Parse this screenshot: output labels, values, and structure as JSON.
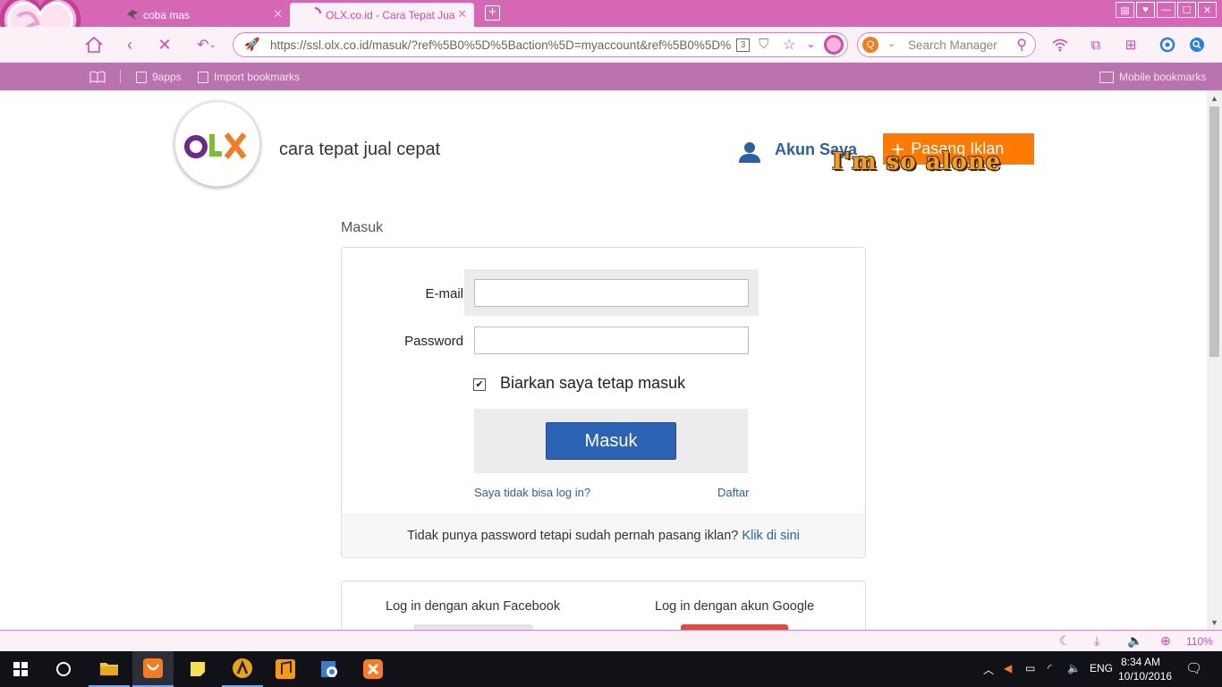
{
  "browser": {
    "tabs": [
      {
        "label": "coba mas",
        "active": false
      },
      {
        "label": "OLX.co.id - Cara Tepat Jua",
        "active": true
      }
    ],
    "url": "https://ssl.olx.co.id/masuk/?ref%5B0%5D%5Baction%5D=myaccount&ref%5B0%5D%",
    "search_placeholder": "Search Manager",
    "bookmarks": [
      "9apps",
      "Import bookmarks"
    ],
    "mobile_bookmarks": "Mobile bookmarks",
    "tab_badge": "3",
    "zoom": "110%",
    "theme_color": "#d667b7"
  },
  "header": {
    "tagline": "cara tepat jual cepat",
    "account_label": "Akun Saya",
    "post_ad_label": "Pasang Iklan",
    "overlay_text": "I'm so alone",
    "accent_color": "#ff7a00",
    "link_color": "#2d5fa6"
  },
  "login": {
    "heading": "Masuk",
    "email_label": "E-mail",
    "email_value": "",
    "password_label": "Password",
    "password_value": "",
    "remember_label": "Biarkan saya tetap masuk",
    "remember_checked": true,
    "submit_label": "Masuk",
    "forgot_link": "Saya tidak bisa log in?",
    "register_link": "Daftar",
    "footer_text": "Tidak punya password tetapi sudah pernah pasang iklan?",
    "footer_link": "Klik di sini",
    "button_color": "#2d63b4"
  },
  "social": {
    "facebook_label": "Log in dengan akun Facebook",
    "google_label": "Log in dengan akun Google",
    "google_color": "#dd4b39"
  },
  "taskbar": {
    "language": "ENG",
    "time": "8:34 AM",
    "date": "10/10/2016"
  }
}
